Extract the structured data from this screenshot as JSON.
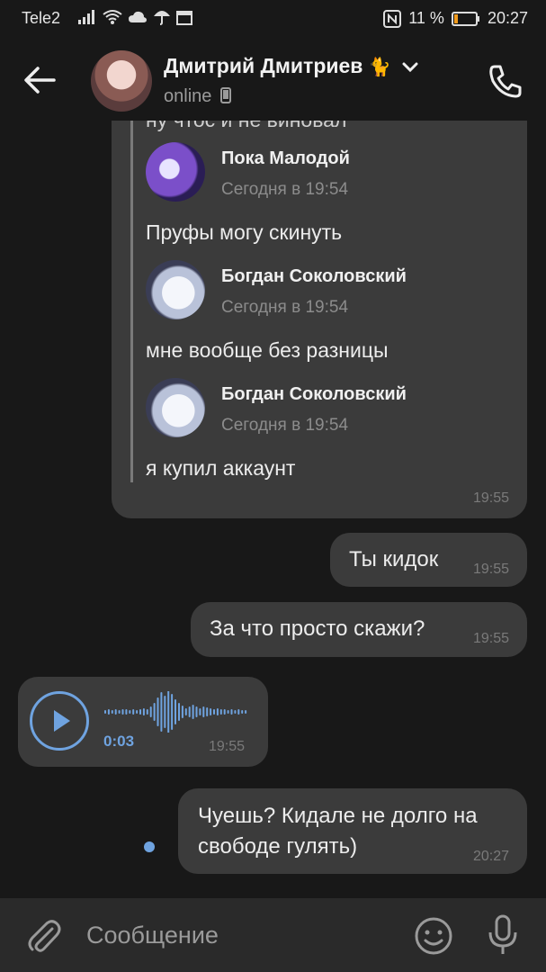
{
  "status_bar": {
    "carrier": "Tele2",
    "battery_pct": "11 %",
    "time": "20:27"
  },
  "header": {
    "name": "Дмитрий Дмитриев",
    "status": "online"
  },
  "forwarded": {
    "cut_text": "ну чтос и не виновал",
    "items": [
      {
        "author": "Пока Малодой",
        "date": "Сегодня в 19:54",
        "text": "Пруфы могу скинуть"
      },
      {
        "author": "Богдан Соколовский",
        "date": "Сегодня в 19:54",
        "text": "мне вообще без разницы"
      },
      {
        "author": "Богдан Соколовский",
        "date": "Сегодня в 19:54",
        "text": "я купил аккаунт"
      }
    ],
    "time": "19:55"
  },
  "messages": [
    {
      "text": "Ты кидок",
      "time": "19:55"
    },
    {
      "text": "За что просто скажи?",
      "time": "19:55"
    }
  ],
  "voice": {
    "duration": "0:03",
    "time": "19:55"
  },
  "last_message": {
    "line1": "Чуешь? Кидале не долго на",
    "line2": "свободе гулять)",
    "time": "20:27"
  },
  "input": {
    "placeholder": "Сообщение"
  },
  "colors": {
    "accent": "#6fa3e0",
    "bubble": "#3b3b3b",
    "background": "#181818"
  }
}
